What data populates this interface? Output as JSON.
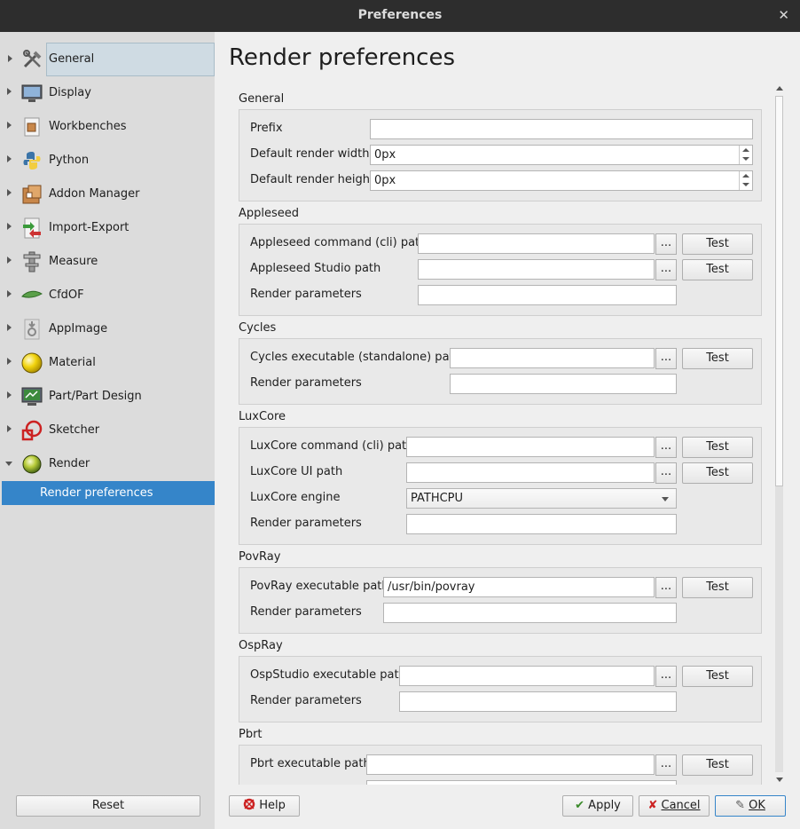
{
  "window": {
    "title": "Preferences",
    "close_icon": "close-icon"
  },
  "sidebar": {
    "items": [
      {
        "label": "General",
        "icon": "tools-icon"
      },
      {
        "label": "Display",
        "icon": "monitor-icon"
      },
      {
        "label": "Workbenches",
        "icon": "workbench-icon"
      },
      {
        "label": "Python",
        "icon": "python-icon"
      },
      {
        "label": "Addon Manager",
        "icon": "addon-icon"
      },
      {
        "label": "Import-Export",
        "icon": "import-export-icon"
      },
      {
        "label": "Measure",
        "icon": "measure-icon"
      },
      {
        "label": "CfdOF",
        "icon": "cfd-icon"
      },
      {
        "label": "AppImage",
        "icon": "appimage-icon"
      },
      {
        "label": "Material",
        "icon": "material-icon"
      },
      {
        "label": "Part/Part Design",
        "icon": "part-design-icon"
      },
      {
        "label": "Sketcher",
        "icon": "sketcher-icon"
      },
      {
        "label": "Render",
        "icon": "render-icon"
      }
    ],
    "subitem": "Render preferences",
    "reset": "Reset"
  },
  "main": {
    "title": "Render preferences",
    "general": {
      "label": "General",
      "prefix": "Prefix",
      "prefix_value": "",
      "width": "Default render width",
      "width_value": "0px",
      "height": "Default render height",
      "height_value": "0px"
    },
    "appleseed": {
      "label": "Appleseed",
      "cli": "Appleseed command (cli) path",
      "studio": "Appleseed Studio path",
      "params": "Render parameters"
    },
    "cycles": {
      "label": "Cycles",
      "exe": "Cycles executable (standalone) path",
      "params": "Render parameters"
    },
    "luxcore": {
      "label": "LuxCore",
      "cli": "LuxCore command (cli) path",
      "ui": "LuxCore UI path",
      "engine": "LuxCore engine",
      "engine_value": "PATHCPU",
      "params": "Render parameters"
    },
    "povray": {
      "label": "PovRay",
      "exe": "PovRay executable path",
      "exe_value": "/usr/bin/povray",
      "params": "Render parameters"
    },
    "ospray": {
      "label": "OspRay",
      "exe": "OspStudio executable path",
      "params": "Render parameters"
    },
    "pbrt": {
      "label": "Pbrt",
      "exe": "Pbrt executable path"
    },
    "browse": "...",
    "test": "Test"
  },
  "footer": {
    "help": "Help",
    "apply": "Apply",
    "cancel": "Cancel",
    "ok": "OK"
  }
}
